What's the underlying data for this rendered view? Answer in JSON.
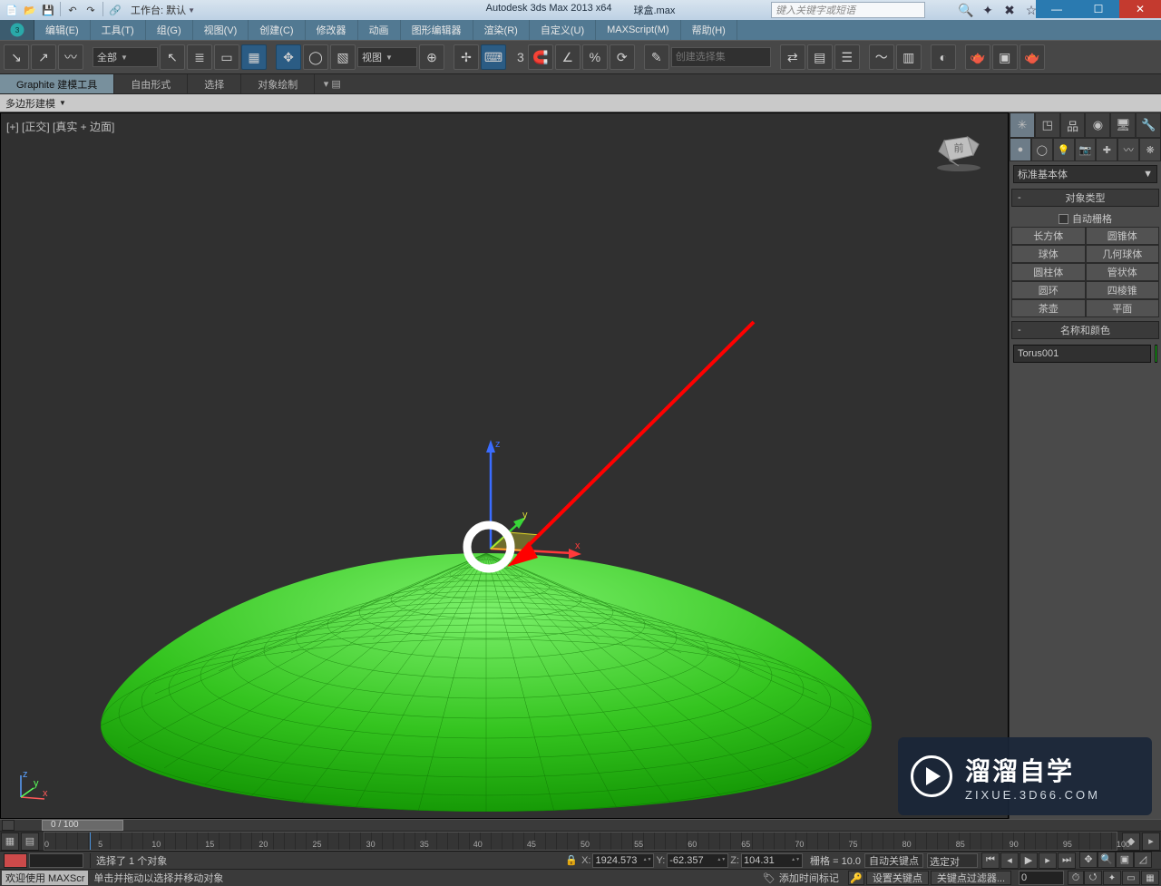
{
  "title": {
    "app": "Autodesk 3ds Max  2013 x64",
    "doc": "球盒.max"
  },
  "workspace_label": "工作台: 默认",
  "help_placeholder": "键入关键字或短语",
  "menu": [
    "编辑(E)",
    "工具(T)",
    "组(G)",
    "视图(V)",
    "创建(C)",
    "修改器",
    "动画",
    "图形编辑器",
    "渲染(R)",
    "自定义(U)",
    "MAXScript(M)",
    "帮助(H)"
  ],
  "toolbar": {
    "filter_combo": "全部",
    "refcoord_combo": "视图",
    "axis_label": "3",
    "named_sel_placeholder": "创建选择集"
  },
  "ribbon": {
    "tabs": [
      "Graphite 建模工具",
      "自由形式",
      "选择",
      "对象绘制"
    ],
    "sub": "多边形建模"
  },
  "viewport": {
    "label": "[+] [正交] [真实 + 边面]"
  },
  "cmdpanel": {
    "category_combo": "标准基本体",
    "roll_object_type": "对象类型",
    "auto_grid": "自动栅格",
    "objects": [
      "长方体",
      "圆锥体",
      "球体",
      "几何球体",
      "圆柱体",
      "管状体",
      "圆环",
      "四棱锥",
      "茶壶",
      "平面"
    ],
    "roll_name_color": "名称和颜色",
    "object_name": "Torus001"
  },
  "timeslider": {
    "label": "0 / 100"
  },
  "track_ticks": [
    "0",
    "5",
    "10",
    "15",
    "20",
    "25",
    "30",
    "35",
    "40",
    "45",
    "50",
    "55",
    "60",
    "65",
    "70",
    "75",
    "80",
    "85",
    "90",
    "95",
    "100"
  ],
  "status": {
    "selection": "选择了 1 个对象",
    "coords": {
      "x": "1924.573",
      "y": "-62.357",
      "z": "104.31"
    },
    "grid": "栅格 = 10.0",
    "autokey": "自动关键点",
    "sel_filter": "选定对",
    "welcome": "欢迎使用  MAXScr",
    "prompt": "单击并拖动以选择并移动对象",
    "add_time_tag": "添加时间标记",
    "set_key": "设置关键点",
    "key_filter": "关键点过滤器..."
  },
  "watermark": {
    "cn": "溜溜自学",
    "en": "ZIXUE.3D66.COM"
  }
}
